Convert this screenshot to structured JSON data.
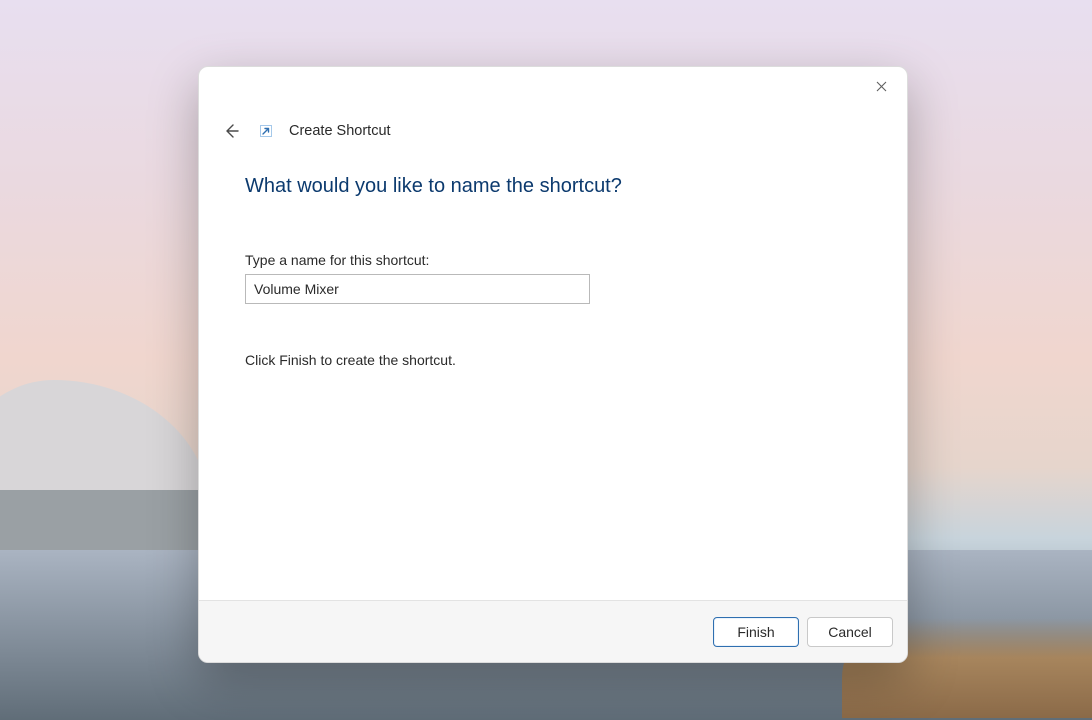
{
  "window": {
    "title": "Create Shortcut"
  },
  "content": {
    "heading": "What would you like to name the shortcut?",
    "field_label": "Type a name for this shortcut:",
    "field_value": "Volume Mixer",
    "hint": "Click Finish to create the shortcut."
  },
  "buttons": {
    "finish": "Finish",
    "cancel": "Cancel"
  }
}
